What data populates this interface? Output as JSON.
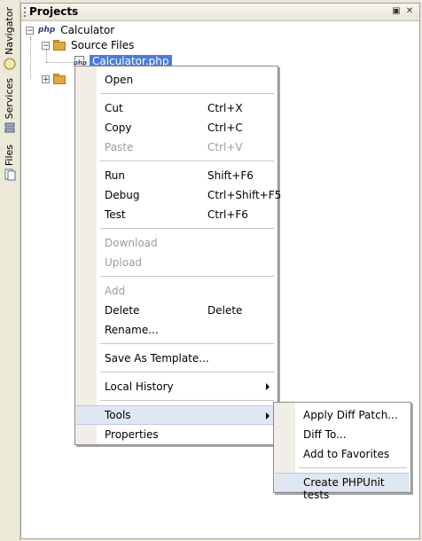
{
  "side_tabs": [
    {
      "label": "Navigator",
      "icon": "navigator-icon"
    },
    {
      "label": "Services",
      "icon": "services-icon"
    },
    {
      "label": "Files",
      "icon": "files-icon"
    }
  ],
  "panel": {
    "title": "Projects",
    "minimize_icon": "minimize-icon",
    "close_icon": "close-icon"
  },
  "tree": {
    "project": {
      "badge": "php",
      "label": "Calculator"
    },
    "source_files": {
      "label": "Source Files"
    },
    "file": {
      "badge": "php",
      "label": "Calculator.php"
    }
  },
  "context_menu": {
    "open": "Open",
    "cut": {
      "label": "Cut",
      "shortcut": "Ctrl+X"
    },
    "copy": {
      "label": "Copy",
      "shortcut": "Ctrl+C"
    },
    "paste": {
      "label": "Paste",
      "shortcut": "Ctrl+V"
    },
    "run": {
      "label": "Run",
      "shortcut": "Shift+F6"
    },
    "debug": {
      "label": "Debug",
      "shortcut": "Ctrl+Shift+F5"
    },
    "test": {
      "label": "Test",
      "shortcut": "Ctrl+F6"
    },
    "download": "Download",
    "upload": "Upload",
    "add": "Add",
    "delete": {
      "label": "Delete",
      "shortcut": "Delete"
    },
    "rename": "Rename...",
    "save_template": "Save As Template...",
    "local_history": "Local History",
    "tools": "Tools",
    "properties": "Properties"
  },
  "tools_submenu": {
    "apply_diff": "Apply Diff Patch...",
    "diff_to": "Diff To...",
    "add_favorites": "Add to Favorites",
    "create_phpunit": "Create PHPUnit tests"
  }
}
